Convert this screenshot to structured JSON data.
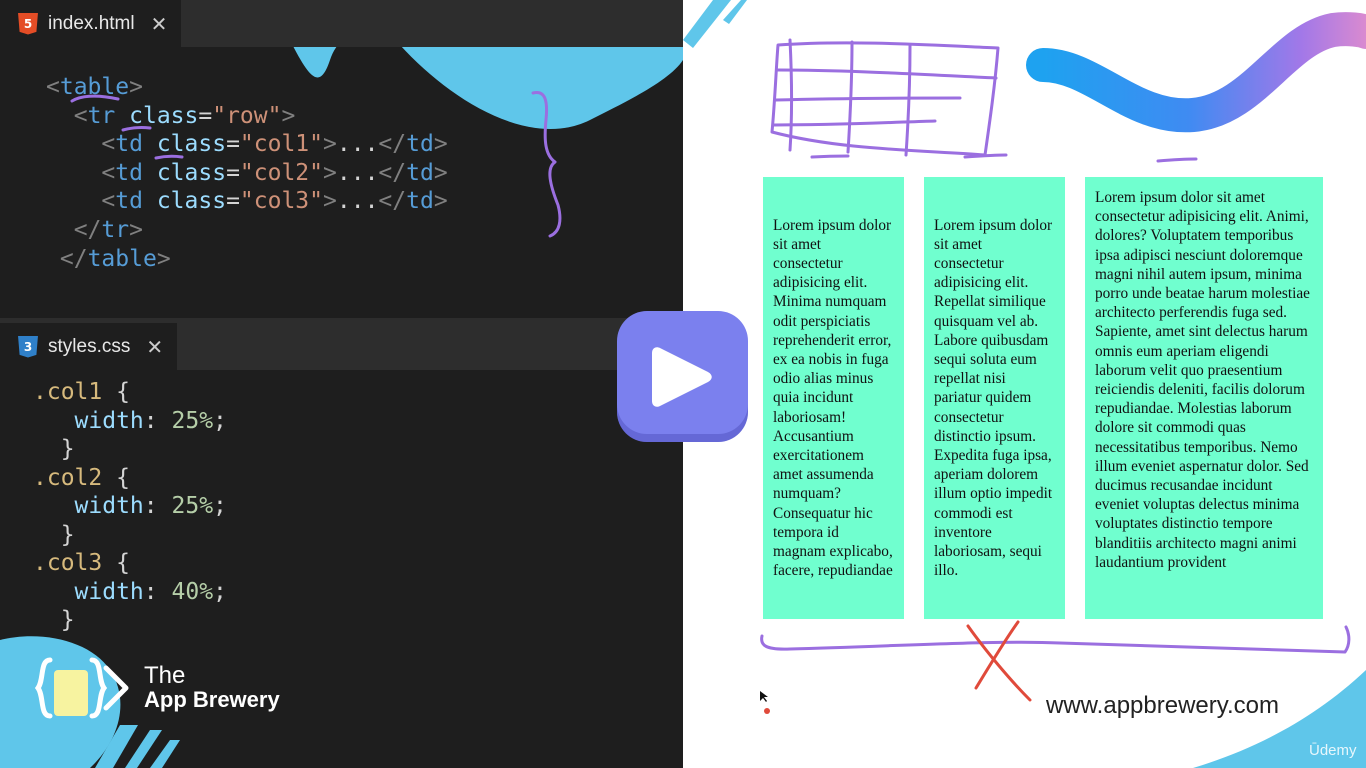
{
  "editor": {
    "html_tab": {
      "filename": "index.html",
      "icon": "html5-icon",
      "close_glyph": "✕"
    },
    "css_tab": {
      "filename": "styles.css",
      "icon": "css3-icon",
      "close_glyph": "✕"
    },
    "html_code": [
      [
        [
          "brk",
          "<"
        ],
        [
          "tag",
          "table"
        ],
        [
          "brk",
          ">"
        ]
      ],
      [
        [
          "txt",
          "  "
        ],
        [
          "brk",
          "<"
        ],
        [
          "tag",
          "tr"
        ],
        [
          "txt",
          " "
        ],
        [
          "attr",
          "class"
        ],
        [
          "eq",
          "="
        ],
        [
          "str",
          "\"row\""
        ],
        [
          "brk",
          ">"
        ]
      ],
      [
        [
          "txt",
          "    "
        ],
        [
          "brk",
          "<"
        ],
        [
          "tag",
          "td"
        ],
        [
          "txt",
          " "
        ],
        [
          "attr",
          "class"
        ],
        [
          "eq",
          "="
        ],
        [
          "str",
          "\"col1\""
        ],
        [
          "brk",
          ">"
        ],
        [
          "txt",
          "..."
        ],
        [
          "brk",
          "</"
        ],
        [
          "tag",
          "td"
        ],
        [
          "brk",
          ">"
        ]
      ],
      [
        [
          "txt",
          "    "
        ],
        [
          "brk",
          "<"
        ],
        [
          "tag",
          "td"
        ],
        [
          "txt",
          " "
        ],
        [
          "attr",
          "class"
        ],
        [
          "eq",
          "="
        ],
        [
          "str",
          "\"col2\""
        ],
        [
          "brk",
          ">"
        ],
        [
          "txt",
          "..."
        ],
        [
          "brk",
          "</"
        ],
        [
          "tag",
          "td"
        ],
        [
          "brk",
          ">"
        ]
      ],
      [
        [
          "txt",
          "    "
        ],
        [
          "brk",
          "<"
        ],
        [
          "tag",
          "td"
        ],
        [
          "txt",
          " "
        ],
        [
          "attr",
          "class"
        ],
        [
          "eq",
          "="
        ],
        [
          "str",
          "\"col3\""
        ],
        [
          "brk",
          ">"
        ],
        [
          "txt",
          "..."
        ],
        [
          "brk",
          "</"
        ],
        [
          "tag",
          "td"
        ],
        [
          "brk",
          ">"
        ]
      ],
      [
        [
          "txt",
          "  "
        ],
        [
          "brk",
          "</"
        ],
        [
          "tag",
          "tr"
        ],
        [
          "brk",
          ">"
        ]
      ],
      [
        [
          "txt",
          " "
        ],
        [
          "brk",
          "</"
        ],
        [
          "tag",
          "table"
        ],
        [
          "brk",
          ">"
        ]
      ]
    ],
    "css_code": [
      [
        [
          "sel",
          ".col1"
        ],
        [
          "txt",
          " {"
        ]
      ],
      [
        [
          "txt",
          "   "
        ],
        [
          "prop",
          "width"
        ],
        [
          "txt",
          ": "
        ],
        [
          "num",
          "25%"
        ],
        [
          "txt",
          ";"
        ]
      ],
      [
        [
          "txt",
          "  }"
        ]
      ],
      [
        [
          "sel",
          ".col2"
        ],
        [
          "txt",
          " {"
        ]
      ],
      [
        [
          "txt",
          "   "
        ],
        [
          "prop",
          "width"
        ],
        [
          "txt",
          ": "
        ],
        [
          "num",
          "25%"
        ],
        [
          "txt",
          ";"
        ]
      ],
      [
        [
          "txt",
          "  }"
        ]
      ],
      [
        [
          "sel",
          ".col3"
        ],
        [
          "txt",
          " {"
        ]
      ],
      [
        [
          "txt",
          "   "
        ],
        [
          "prop",
          "width"
        ],
        [
          "txt",
          ": "
        ],
        [
          "num",
          "40%"
        ],
        [
          "txt",
          ";"
        ]
      ],
      [
        [
          "txt",
          "  }"
        ]
      ]
    ]
  },
  "preview": {
    "cells": [
      "Lorem ipsum dolor sit amet consectetur adipisicing elit. Minima numquam odit perspiciatis reprehenderit error, ex ea nobis in fuga odio alias minus quia incidunt laboriosam! Accusantium exercitationem amet assumenda numquam? Consequatur hic tempora id magnam explicabo, facere, repudiandae",
      "Lorem ipsum dolor sit amet consectetur adipisicing elit. Repellat similique quisquam vel ab. Labore quibusdam sequi soluta eum repellat nisi pariatur quidem consectetur distinctio ipsum. Expedita fuga ipsa, aperiam dolorem illum optio impedit commodi est inventore laboriosam, sequi illo.",
      "Lorem ipsum dolor sit amet consectetur adipisicing elit. Animi, dolores? Voluptatem temporibus ipsa adipisci nesciunt doloremque magni nihil autem ipsum, minima porro unde beatae harum molestiae architecto perferendis fuga sed. Sapiente, amet sint delectus harum omnis eum aperiam eligendi laborum velit quo praesentium reiciendis deleniti, facilis dolorum repudiandae. Molestias laborum dolore sit commodi quas necessitatibus temporibus. Nemo illum eveniet aspernatur dolor. Sed ducimus recusandae incidunt eveniet voluptas delectus minima voluptates distinctio tempore blanditiis architecto magni animi laudantium provident"
    ],
    "cell_color": "#70ffcf",
    "website": "www.appbrewery.com",
    "watermark": "Ūdemy"
  },
  "brand": {
    "line1": "The",
    "line2": "App Brewery"
  },
  "player": {
    "icon": "play-icon",
    "color": "#7b80ee"
  },
  "colors": {
    "editor_bg": "#1e1e1e",
    "tabbar_bg": "#2d2d2d",
    "annotation_purple": "#9b6fe0",
    "annotation_red": "#e04a3b",
    "deco_blue": "#5fc6ea"
  }
}
